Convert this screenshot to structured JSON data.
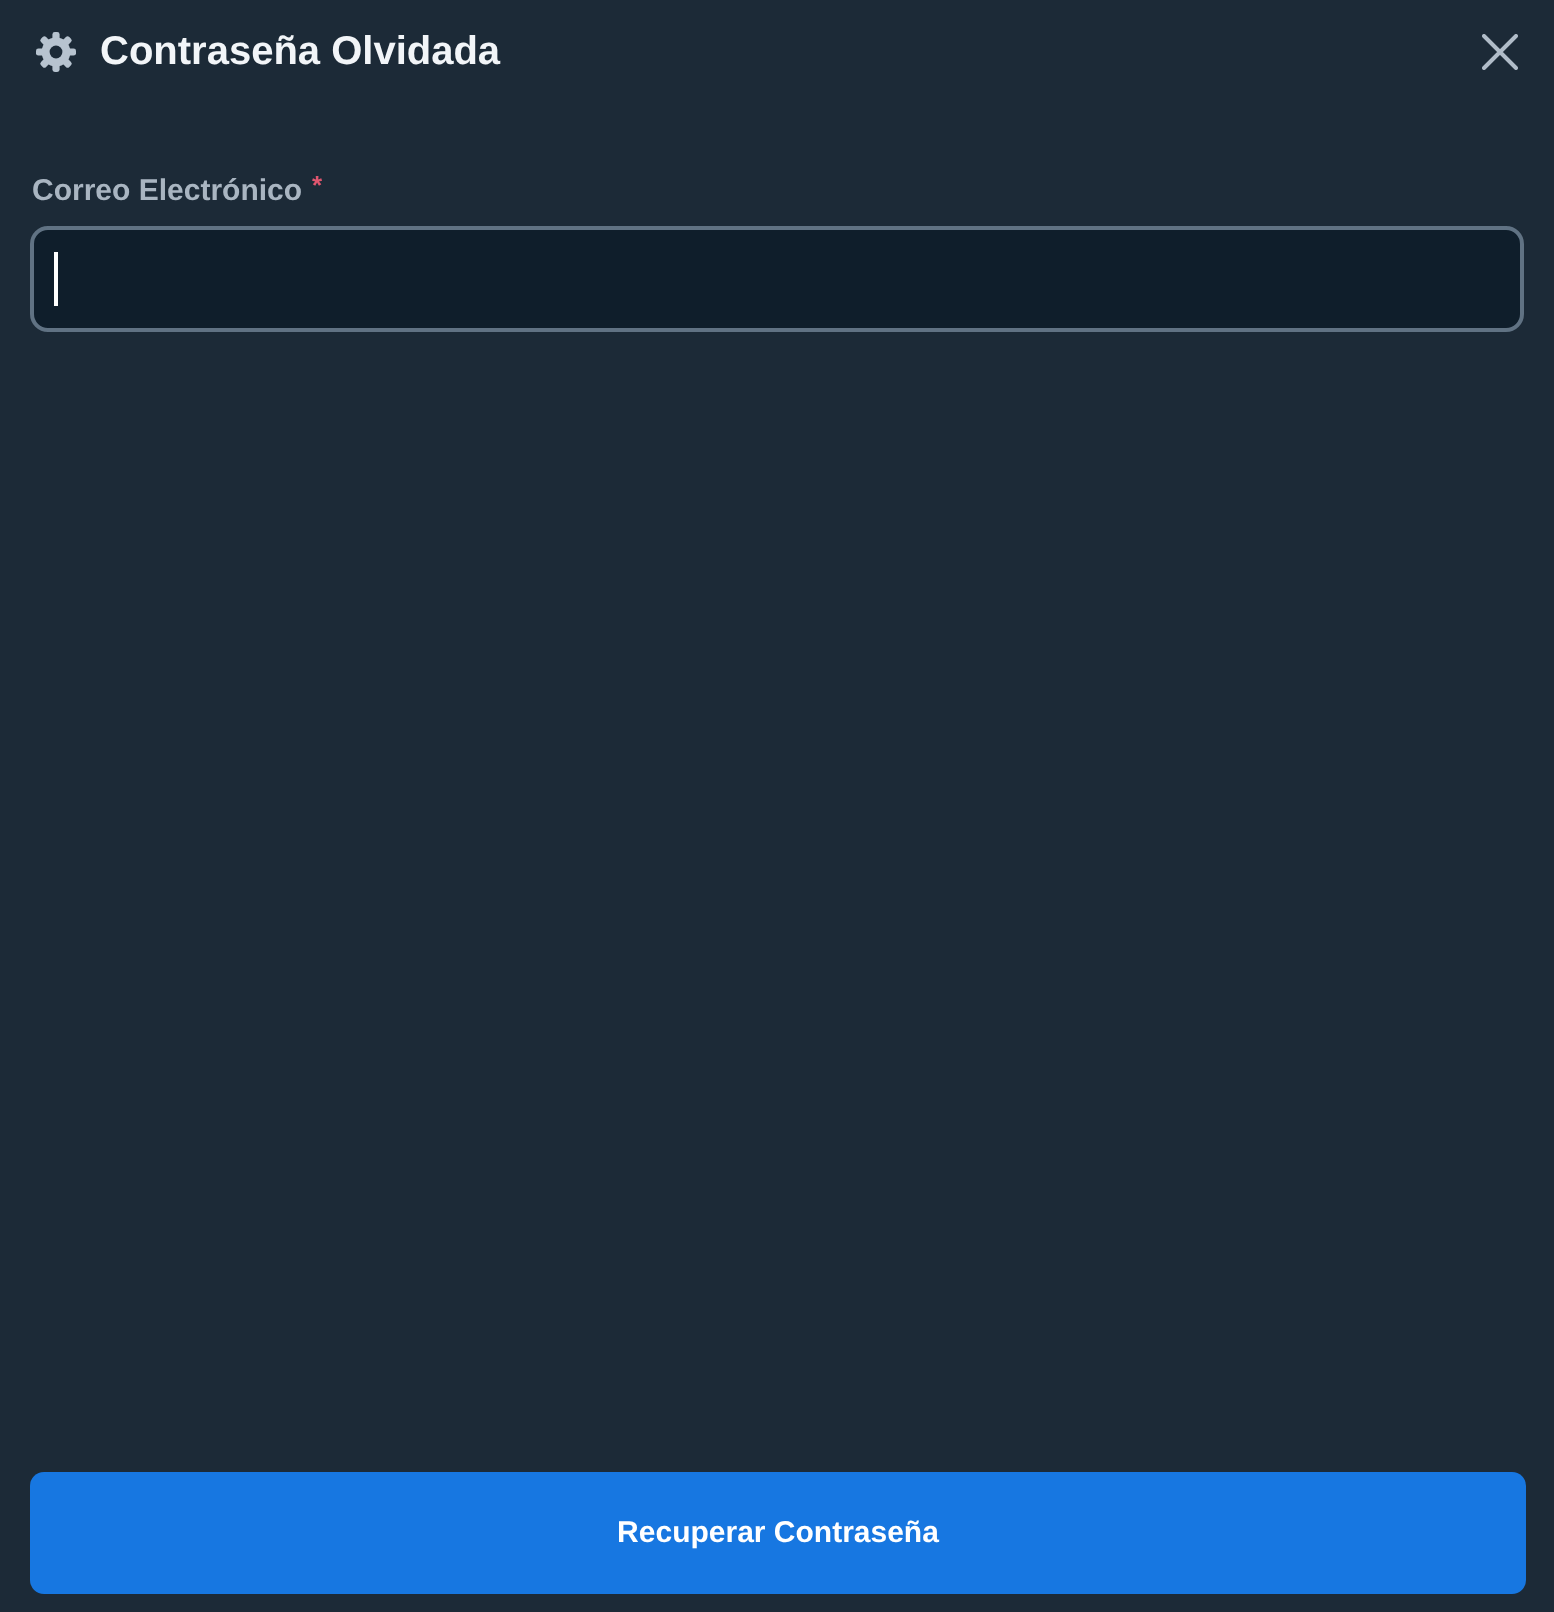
{
  "dialog": {
    "title": "Contraseña Olvidada"
  },
  "form": {
    "email_field": {
      "label": "Correo Electrónico",
      "required_mark": "*",
      "focused": true
    }
  },
  "actions": {
    "submit_button": {
      "label": "Recuperar Contraseña"
    }
  }
}
